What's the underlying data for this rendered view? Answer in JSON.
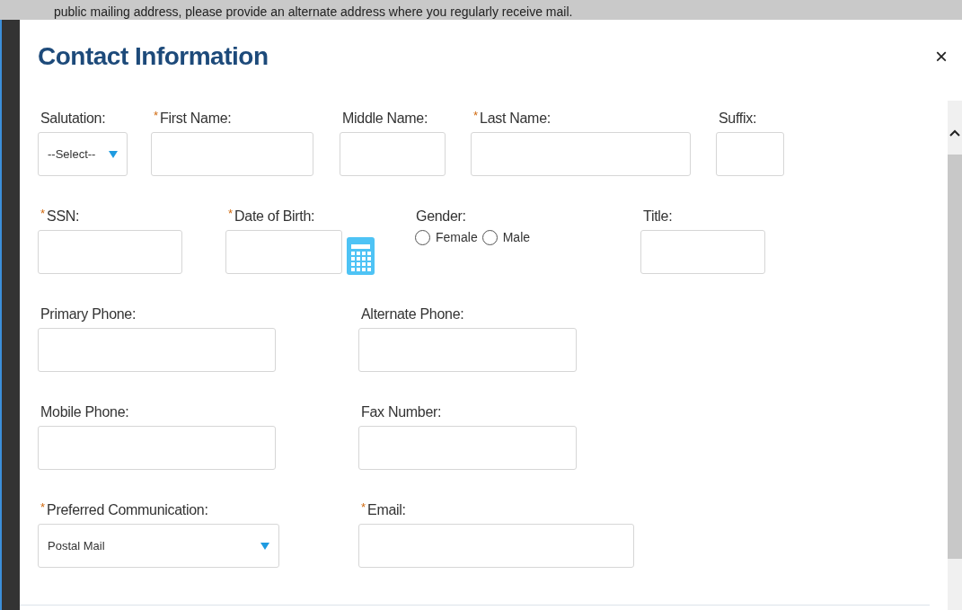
{
  "background_text": "public mailing address, please provide an alternate address where you regularly receive mail.",
  "dialog": {
    "title": "Contact Information",
    "close": "×"
  },
  "rows": [
    [
      {
        "kind": "select",
        "label": "Salutation:",
        "value": "--Select--"
      },
      {
        "kind": "text",
        "label": "First Name:",
        "marker": "*"
      },
      {
        "kind": "text",
        "label": "Middle Name:"
      },
      {
        "kind": "text",
        "label": "Last Name:",
        "marker": "*"
      },
      {
        "kind": "text",
        "label": "Suffix:"
      }
    ],
    [
      {
        "kind": "text",
        "label": "SSN:",
        "marker": "*"
      },
      {
        "kind": "date",
        "label": "Date of Birth:",
        "marker": "*"
      },
      {
        "kind": "radio",
        "label": "Gender:",
        "options": [
          {
            "label": "Female",
            "selected": false
          },
          {
            "label": "Male",
            "selected": false
          }
        ]
      },
      {
        "kind": "text",
        "label": "Title:"
      }
    ],
    [
      {
        "kind": "text",
        "label": "Primary Phone:"
      },
      {
        "kind": "text",
        "label": "Alternate Phone:"
      }
    ],
    [
      {
        "kind": "text",
        "label": "Mobile Phone:"
      },
      {
        "kind": "text",
        "label": "Fax Number:"
      }
    ],
    [
      {
        "kind": "select",
        "label": "Preferred Communication:",
        "marker": "*",
        "value": "Postal Mail"
      },
      {
        "kind": "text",
        "label": "Email:",
        "marker": "*"
      }
    ]
  ]
}
